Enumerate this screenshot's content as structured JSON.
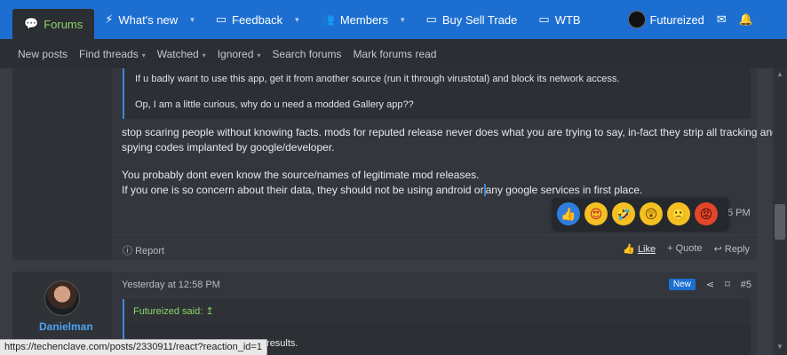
{
  "nav": {
    "tabs": [
      {
        "label": "Forums",
        "icon": "chat-icon"
      },
      {
        "label": "What's new",
        "icon": "lightning-icon"
      },
      {
        "label": "Feedback",
        "icon": "folder-icon"
      },
      {
        "label": "Members",
        "icon": "people-icon"
      },
      {
        "label": "Buy Sell Trade",
        "icon": "folder-icon"
      },
      {
        "label": "WTB",
        "icon": "folder-icon"
      }
    ],
    "username": "Futureized"
  },
  "subnav": [
    "New posts",
    "Find threads",
    "Watched",
    "Ignored",
    "Search forums",
    "Mark forums read"
  ],
  "post1": {
    "quote_lines": [
      "If u badly want to use this app, get it from another source (run it through virustotal) and block its network access.",
      "Op, I am a little curious, why do u need a modded Gallery app??"
    ],
    "body_lines": [
      "stop scaring people without knowing facts. mods for reputed release never does what you are trying to say, in-fact they strip all tracking and",
      "spying codes implanted by google/developer.",
      "You probably dont even know the source/names of legitimate mod releases.",
      "If you one is so concern about their data, they should not be using android or",
      "any google services in first place."
    ],
    "time_partial": "5 PM",
    "report": "Report",
    "like": "Like",
    "quote": "Quote",
    "reply": "Reply"
  },
  "post2": {
    "username": "Danielman",
    "time": "Yesterday at 12:58 PM",
    "badge": "New",
    "number": "#5",
    "quote_head": "Futureized said:",
    "quote_text": "here are results."
  },
  "statusbar": "https://techenclave.com/posts/2330911/react?reaction_id=1"
}
